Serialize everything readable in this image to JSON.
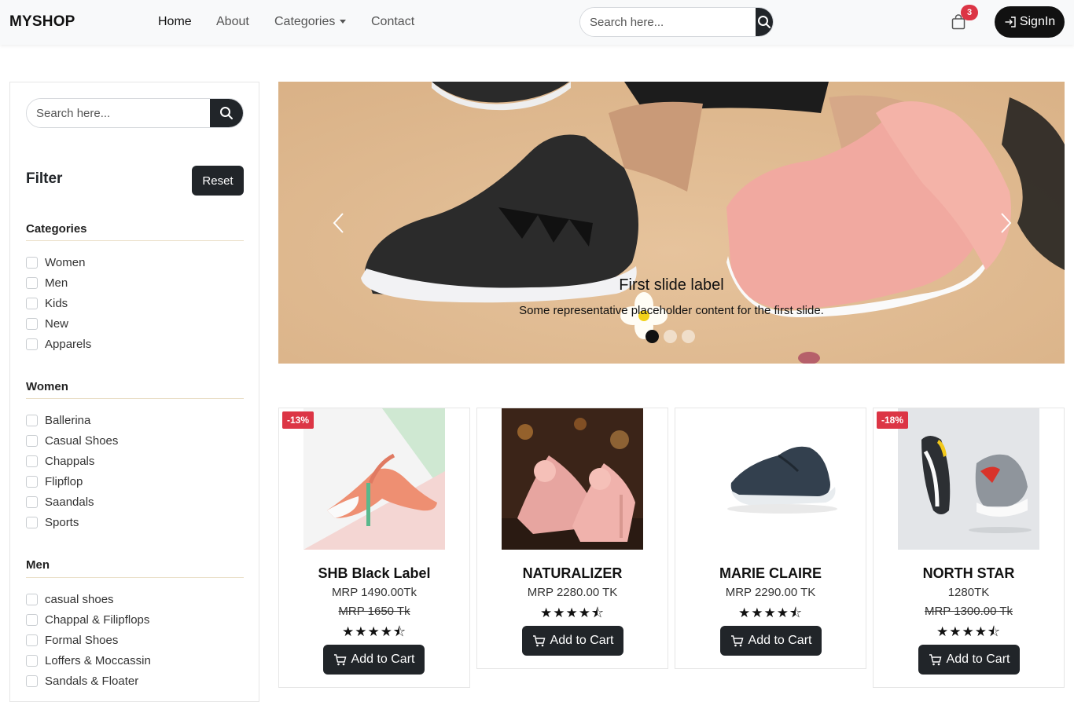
{
  "brand": "MYSHOP",
  "nav": {
    "home": "Home",
    "about": "About",
    "categories": "Categories",
    "contact": "Contact"
  },
  "header_search": {
    "placeholder": "Search here..."
  },
  "cart": {
    "count": "3"
  },
  "signin": {
    "label": "SignIn"
  },
  "sidebar": {
    "search_placeholder": "Search here...",
    "filter_title": "Filter",
    "reset_label": "Reset",
    "groups": [
      {
        "title": "Categories",
        "items": [
          "Women",
          "Men",
          "Kids",
          "New",
          "Apparels"
        ]
      },
      {
        "title": "Women",
        "items": [
          "Ballerina",
          "Casual Shoes",
          "Chappals",
          "Flipflop",
          "Saandals",
          "Sports"
        ]
      },
      {
        "title": "Men",
        "items": [
          "casual shoes",
          "Chappal & Filipflops",
          "Formal Shoes",
          "Loffers & Moccassin",
          "Sandals & Floater"
        ]
      }
    ]
  },
  "carousel": {
    "title": "First slide label",
    "text": "Some representative placeholder content for the first slide.",
    "active_index": 0
  },
  "products": [
    {
      "name": "SHB Black Label",
      "price": "MRP 1490.00Tk",
      "old_price": "MRP 1650 Tk",
      "discount": "-13%",
      "rating": 4.5,
      "stars": "★★★★⯪",
      "cart_label": "Add to Cart"
    },
    {
      "name": "NATURALIZER",
      "price": "MRP 2280.00 TK",
      "old_price": "",
      "discount": "",
      "rating": 4.5,
      "stars": "★★★★⯪",
      "cart_label": "Add to Cart"
    },
    {
      "name": "MARIE CLAIRE",
      "price": "MRP 2290.00 TK",
      "old_price": "",
      "discount": "",
      "rating": 4.5,
      "stars": "★★★★⯪",
      "cart_label": "Add to Cart"
    },
    {
      "name": "NORTH STAR",
      "price": "1280TK",
      "old_price": "MRP 1300.00 Tk",
      "discount": "-18%",
      "rating": 4.5,
      "stars": "★★★★⯪",
      "cart_label": "Add to Cart"
    }
  ],
  "colors": {
    "dark": "#212529",
    "badge": "#dc3545",
    "navbar": "#f8f9fa"
  }
}
